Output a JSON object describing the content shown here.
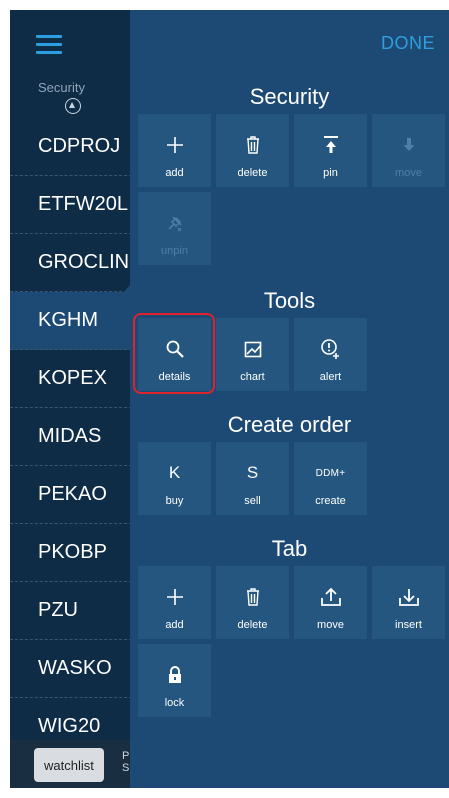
{
  "sidebar": {
    "column_header": "Security",
    "securities": [
      {
        "name": "CDPROJ"
      },
      {
        "name": "ETFW20L"
      },
      {
        "name": "GROCLIN"
      },
      {
        "name": "KGHM",
        "active": true
      },
      {
        "name": "KOPEX"
      },
      {
        "name": "MIDAS"
      },
      {
        "name": "PEKAO"
      },
      {
        "name": "PKOBP"
      },
      {
        "name": "PZU"
      },
      {
        "name": "WASKO"
      },
      {
        "name": "WIG20"
      }
    ],
    "bottom_tabs": {
      "watchlist": "watchlist",
      "partial": "P S"
    }
  },
  "panel": {
    "done_label": "DONE",
    "sections": {
      "security": {
        "title": "Security",
        "actions": {
          "add": "add",
          "delete": "delete",
          "pin": "pin",
          "move": "move",
          "unpin": "unpin"
        }
      },
      "tools": {
        "title": "Tools",
        "actions": {
          "details": "details",
          "chart": "chart",
          "alert": "alert"
        }
      },
      "create_order": {
        "title": "Create order",
        "actions": {
          "buy": "buy",
          "buy_glyph": "K",
          "sell": "sell",
          "sell_glyph": "S",
          "create": "create",
          "create_glyph": "DDM+"
        }
      },
      "tab": {
        "title": "Tab",
        "actions": {
          "add": "add",
          "delete": "delete",
          "move": "move",
          "insert": "insert",
          "lock": "lock"
        }
      }
    }
  },
  "colors": {
    "accent": "#2e9fde",
    "sidebar_bg": "#0f2c47",
    "panel_bg": "#1d4a74",
    "tile_bg": "#24567f",
    "highlight": "#e0222e"
  }
}
